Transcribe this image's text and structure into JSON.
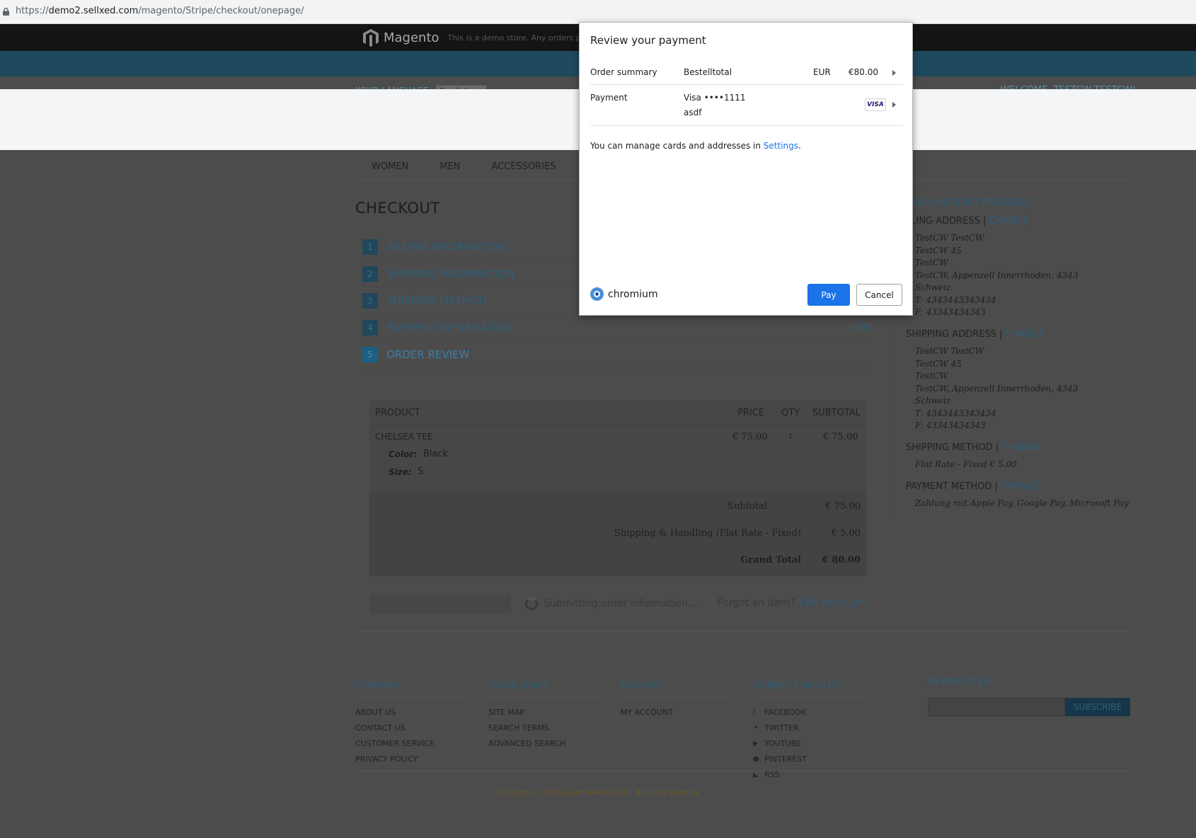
{
  "browser": {
    "url_scheme": "https://",
    "url_host": "demo2.sellxed.com",
    "url_path": "/magento/Stripe/checkout/onepage/"
  },
  "store": {
    "brand_name": "Magento",
    "demo_notice": "This is a demo store. Any orders placed",
    "language_label": "YOUR LANGUAGE:",
    "language_value": "English",
    "welcome": "WELCOME, TESTCW TESTCW!",
    "nav": [
      "WOMEN",
      "MEN",
      "ACCESSORIES"
    ]
  },
  "checkout": {
    "title": "CHECKOUT",
    "steps": [
      {
        "num": "1",
        "label": "BILLING INFORMATION"
      },
      {
        "num": "2",
        "label": "SHIPPING INFORMATION"
      },
      {
        "num": "3",
        "label": "SHIPPING METHOD"
      },
      {
        "num": "4",
        "label": "PAYMENT INFORMATION",
        "edit": "Edit"
      },
      {
        "num": "5",
        "label": "ORDER REVIEW"
      }
    ],
    "table": {
      "headers": {
        "product": "PRODUCT",
        "price": "PRICE",
        "qty": "QTY",
        "subtotal": "SUBTOTAL"
      },
      "item": {
        "name": "CHELSEA TEE",
        "price": "€ 75.00",
        "qty": "1",
        "subtotal": "€ 75.00",
        "color_label": "Color:",
        "color_value": "Black",
        "size_label": "Size:",
        "size_value": "S"
      },
      "totals": {
        "subtotal_label": "Subtotal",
        "subtotal_value": "€ 75.00",
        "shipping_label": "Shipping & Handling (Flat Rate - Fixed)",
        "shipping_value": "€ 5.00",
        "grand_label": "Grand Total",
        "grand_value": "€ 80.00"
      }
    },
    "submitting": "Submitting order information...",
    "forgot": "Forgot an Item?",
    "edit_cart": "Edit Your Cart"
  },
  "progress": {
    "title": "OUR CHECKOUT PROGRESS",
    "billing_label": "LLING ADDRESS",
    "shipping_label": "SHIPPING ADDRESS",
    "method_label": "SHIPPING METHOD",
    "payment_label": "PAYMENT METHOD",
    "sep": "|",
    "change": "CHANGE",
    "billing_lines": [
      "TestCW TestCW",
      "TestCW 45",
      "TestCW",
      "TestCW, Appenzell Innerrhoden, 4343",
      "Schweiz",
      "T: 4343443343434",
      "F: 43343434343"
    ],
    "shipping_lines": [
      "TestCW TestCW",
      "TestCW 45",
      "TestCW",
      "TestCW, Appenzell Innerrhoden, 4343",
      "Schweiz",
      "T: 4343443343434",
      "F: 43343434343"
    ],
    "method_value": "Flat Rate - Fixed € 5.00",
    "payment_value": "Zahlung mit Apple Pay, Google Pay, Microsoft Pay"
  },
  "footer": {
    "company": {
      "title": "COMPANY",
      "links": [
        "ABOUT US",
        "CONTACT US",
        "CUSTOMER SERVICE",
        "PRIVACY POLICY"
      ]
    },
    "quick": {
      "title": "QUICK LINKS",
      "links": [
        "SITE MAP",
        "SEARCH TERMS",
        "ADVANCED SEARCH"
      ]
    },
    "account": {
      "title": "ACCOUNT",
      "links": [
        "MY ACCOUNT"
      ]
    },
    "connect": {
      "title": "CONNECT WITH US",
      "links": [
        "FACEBOOK",
        "TWITTER",
        "YOUTUBE",
        "PINTEREST",
        "RSS"
      ]
    },
    "newsletter": {
      "title": "NEWSLETTER",
      "button": "SUBSCRIBE"
    },
    "copyright": "Copyright © 2015 customweb GmbH - Business Systems"
  },
  "dialog": {
    "title": "Review your payment",
    "order_summary_label": "Order summary",
    "order_summary_value": "Bestelltotal",
    "currency": "EUR",
    "amount": "€80.00",
    "payment_label": "Payment",
    "card": "Visa ••••1111",
    "card_holder": "asdf",
    "card_brand": "VISA",
    "manage_text": "You can manage cards and addresses in",
    "settings_link": "Settings",
    "period": ".",
    "browser_name": "chromium",
    "pay": "Pay",
    "cancel": "Cancel"
  },
  "colors": {
    "overlay": "#4c4c4c",
    "accent": "#1a73e8",
    "link_dim": "#2f5f78"
  }
}
